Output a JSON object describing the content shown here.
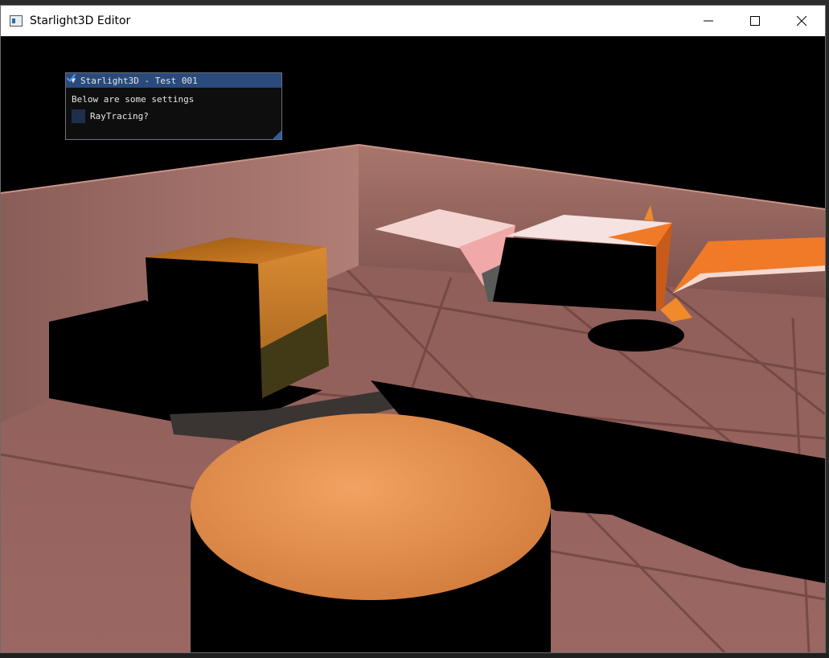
{
  "window": {
    "title": "Starlight3D Editor",
    "app_icon": "app-window-icon",
    "controls": [
      {
        "name": "minimize",
        "icon": "minimize-icon"
      },
      {
        "name": "maximize",
        "icon": "maximize-icon"
      },
      {
        "name": "close",
        "icon": "close-icon"
      }
    ]
  },
  "panel": {
    "title": "Starlight3D - Test 001",
    "collapse_glyph": "▼",
    "text": "Below are some settings",
    "checkbox_label": "RayTracing?",
    "checkbox_checked": true
  },
  "colors": {
    "panel_title_bg": "#294a7a",
    "checkbox_bg": "#1d2f4d",
    "checkmark": "#4296fa",
    "wall": "#9a6a62",
    "floor": "#8c5a55",
    "orange": "#f07a28"
  }
}
